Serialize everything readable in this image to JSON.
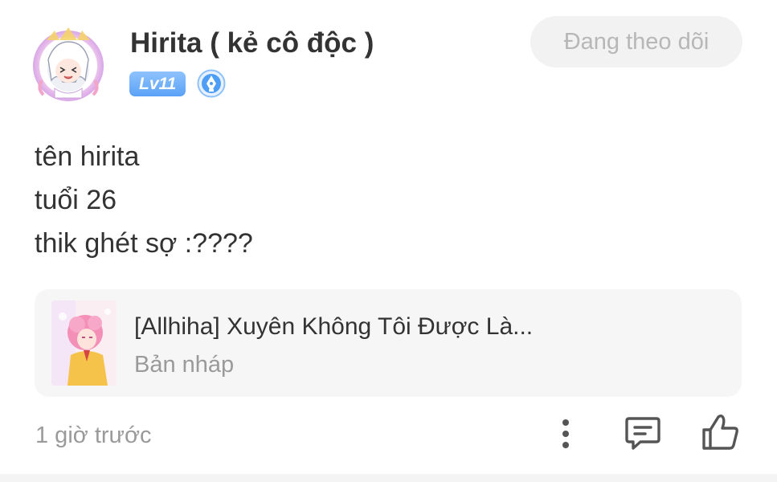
{
  "header": {
    "username": "Hirita ( kẻ cô độc )",
    "level_badge": "Lv11",
    "level_badge_color": "#6aaef9",
    "pen_badge_icon": "pen-nib-icon",
    "follow_label": "Đang theo dõi"
  },
  "content": {
    "lines": [
      "tên hirita",
      "tuổi 26",
      "thik ghét sợ :????"
    ]
  },
  "story": {
    "title": "[Allhiha] Xuyên Không Tôi Được Là...",
    "status": "Bản nháp"
  },
  "footer": {
    "timestamp": "1 giờ trước",
    "icons": [
      "more-vertical-icon",
      "comment-icon",
      "like-icon"
    ]
  }
}
